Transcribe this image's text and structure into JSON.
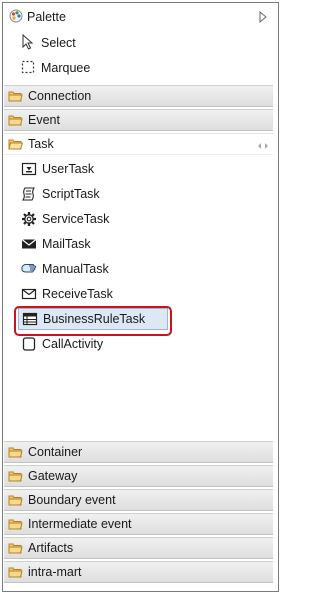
{
  "palette": {
    "title": "Palette",
    "tools": [
      {
        "label": "Select",
        "icon": "arrow-cursor-icon"
      },
      {
        "label": "Marquee",
        "icon": "marquee-icon"
      }
    ],
    "drawers_top": [
      {
        "label": "Connection"
      },
      {
        "label": "Event"
      }
    ],
    "task_drawer": {
      "label": "Task",
      "items": [
        {
          "label": "UserTask",
          "icon": "user-task-icon"
        },
        {
          "label": "ScriptTask",
          "icon": "script-task-icon"
        },
        {
          "label": "ServiceTask",
          "icon": "service-task-icon"
        },
        {
          "label": "MailTask",
          "icon": "mail-task-icon"
        },
        {
          "label": "ManualTask",
          "icon": "manual-task-icon"
        },
        {
          "label": "ReceiveTask",
          "icon": "receive-task-icon"
        },
        {
          "label": "BusinessRuleTask",
          "icon": "business-rule-task-icon",
          "selected": true
        },
        {
          "label": "CallActivity",
          "icon": "call-activity-icon"
        }
      ]
    },
    "drawers_bottom": [
      {
        "label": "Container"
      },
      {
        "label": "Gateway"
      },
      {
        "label": "Boundary event"
      },
      {
        "label": "Intermediate event"
      },
      {
        "label": "Artifacts"
      },
      {
        "label": "intra-mart"
      }
    ]
  },
  "colors": {
    "drawer_gradient_top": "#f0f0f0",
    "drawer_gradient_bottom": "#dedede",
    "folder": "#e8b04a",
    "selection_fill": "#dde8f6",
    "highlight_ring": "#c8141a"
  }
}
